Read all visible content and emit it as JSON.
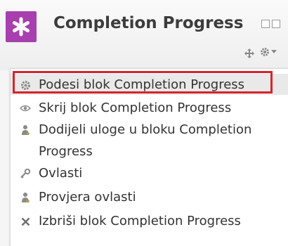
{
  "block": {
    "title": "Completion Progress",
    "icon": "puzzle-star-icon"
  },
  "header_controls": {
    "dock_icons": [
      "dock-minimize-icon",
      "dock-icon"
    ],
    "move_icon": "move-arrows-icon",
    "actions_icon": "gear-icon"
  },
  "menu": {
    "items": [
      {
        "icon": "gear-icon",
        "label": "Podesi blok Completion Progress"
      },
      {
        "icon": "eye-icon",
        "label": "Skrij blok Completion Progress"
      },
      {
        "icon": "user-assign-icon",
        "label": "Dodijeli uloge u bloku Completion Progress"
      },
      {
        "icon": "key-icon",
        "label": "Ovlasti"
      },
      {
        "icon": "user-check-icon",
        "label": "Provjera ovlasti"
      },
      {
        "icon": "delete-icon",
        "label": "Izbriši blok Completion Progress"
      }
    ]
  },
  "colors": {
    "accent": "#a73fae",
    "highlight_border": "#d7232e"
  }
}
